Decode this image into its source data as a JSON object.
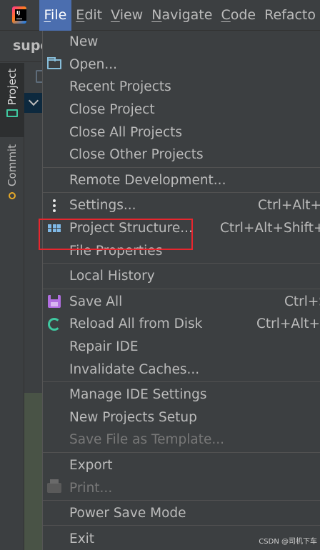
{
  "menubar": {
    "items": [
      "File",
      "Edit",
      "View",
      "Navigate",
      "Code",
      "Refacto"
    ],
    "active_index": 0
  },
  "titlebar": {
    "project_name": "supe"
  },
  "toolstrip": {
    "project_tab": "Project",
    "commit_tab": "Commit"
  },
  "file_menu": {
    "groups": [
      [
        {
          "label": "New",
          "icon": null
        },
        {
          "label": "Open...",
          "icon": "folder-icon"
        },
        {
          "label": "Recent Projects",
          "icon": null
        },
        {
          "label": "Close Project",
          "icon": null
        },
        {
          "label": "Close All Projects",
          "icon": null
        },
        {
          "label": "Close Other Projects",
          "icon": null
        }
      ],
      [
        {
          "label": "Remote Development...",
          "icon": null
        }
      ],
      [
        {
          "label": "Settings...",
          "icon": "dots-icon",
          "shortcut": "Ctrl+Alt+S"
        },
        {
          "label": "Project Structure...",
          "icon": "grid-icon",
          "shortcut": "Ctrl+Alt+Shift+S"
        },
        {
          "label": "File Properties",
          "icon": null
        }
      ],
      [
        {
          "label": "Local History",
          "icon": null
        }
      ],
      [
        {
          "label": "Save All",
          "icon": "save-icon",
          "shortcut": "Ctrl+S"
        },
        {
          "label": "Reload All from Disk",
          "icon": "reload-icon",
          "shortcut": "Ctrl+Alt+Y"
        },
        {
          "label": "Repair IDE",
          "icon": null
        },
        {
          "label": "Invalidate Caches...",
          "icon": null
        }
      ],
      [
        {
          "label": "Manage IDE Settings",
          "icon": null
        },
        {
          "label": "New Projects Setup",
          "icon": null
        },
        {
          "label": "Save File as Template...",
          "icon": null,
          "disabled": true
        }
      ],
      [
        {
          "label": "Export",
          "icon": null
        },
        {
          "label": "Print...",
          "icon": "print-icon",
          "disabled": true
        }
      ],
      [
        {
          "label": "Power Save Mode",
          "icon": null
        }
      ],
      [
        {
          "label": "Exit",
          "icon": null
        }
      ]
    ]
  },
  "watermark": "CSDN @司机下车",
  "colors": {
    "menu_bg": "#3c3f41",
    "active_menu": "#4b6eaf",
    "highlight_border": "#e8262e"
  }
}
